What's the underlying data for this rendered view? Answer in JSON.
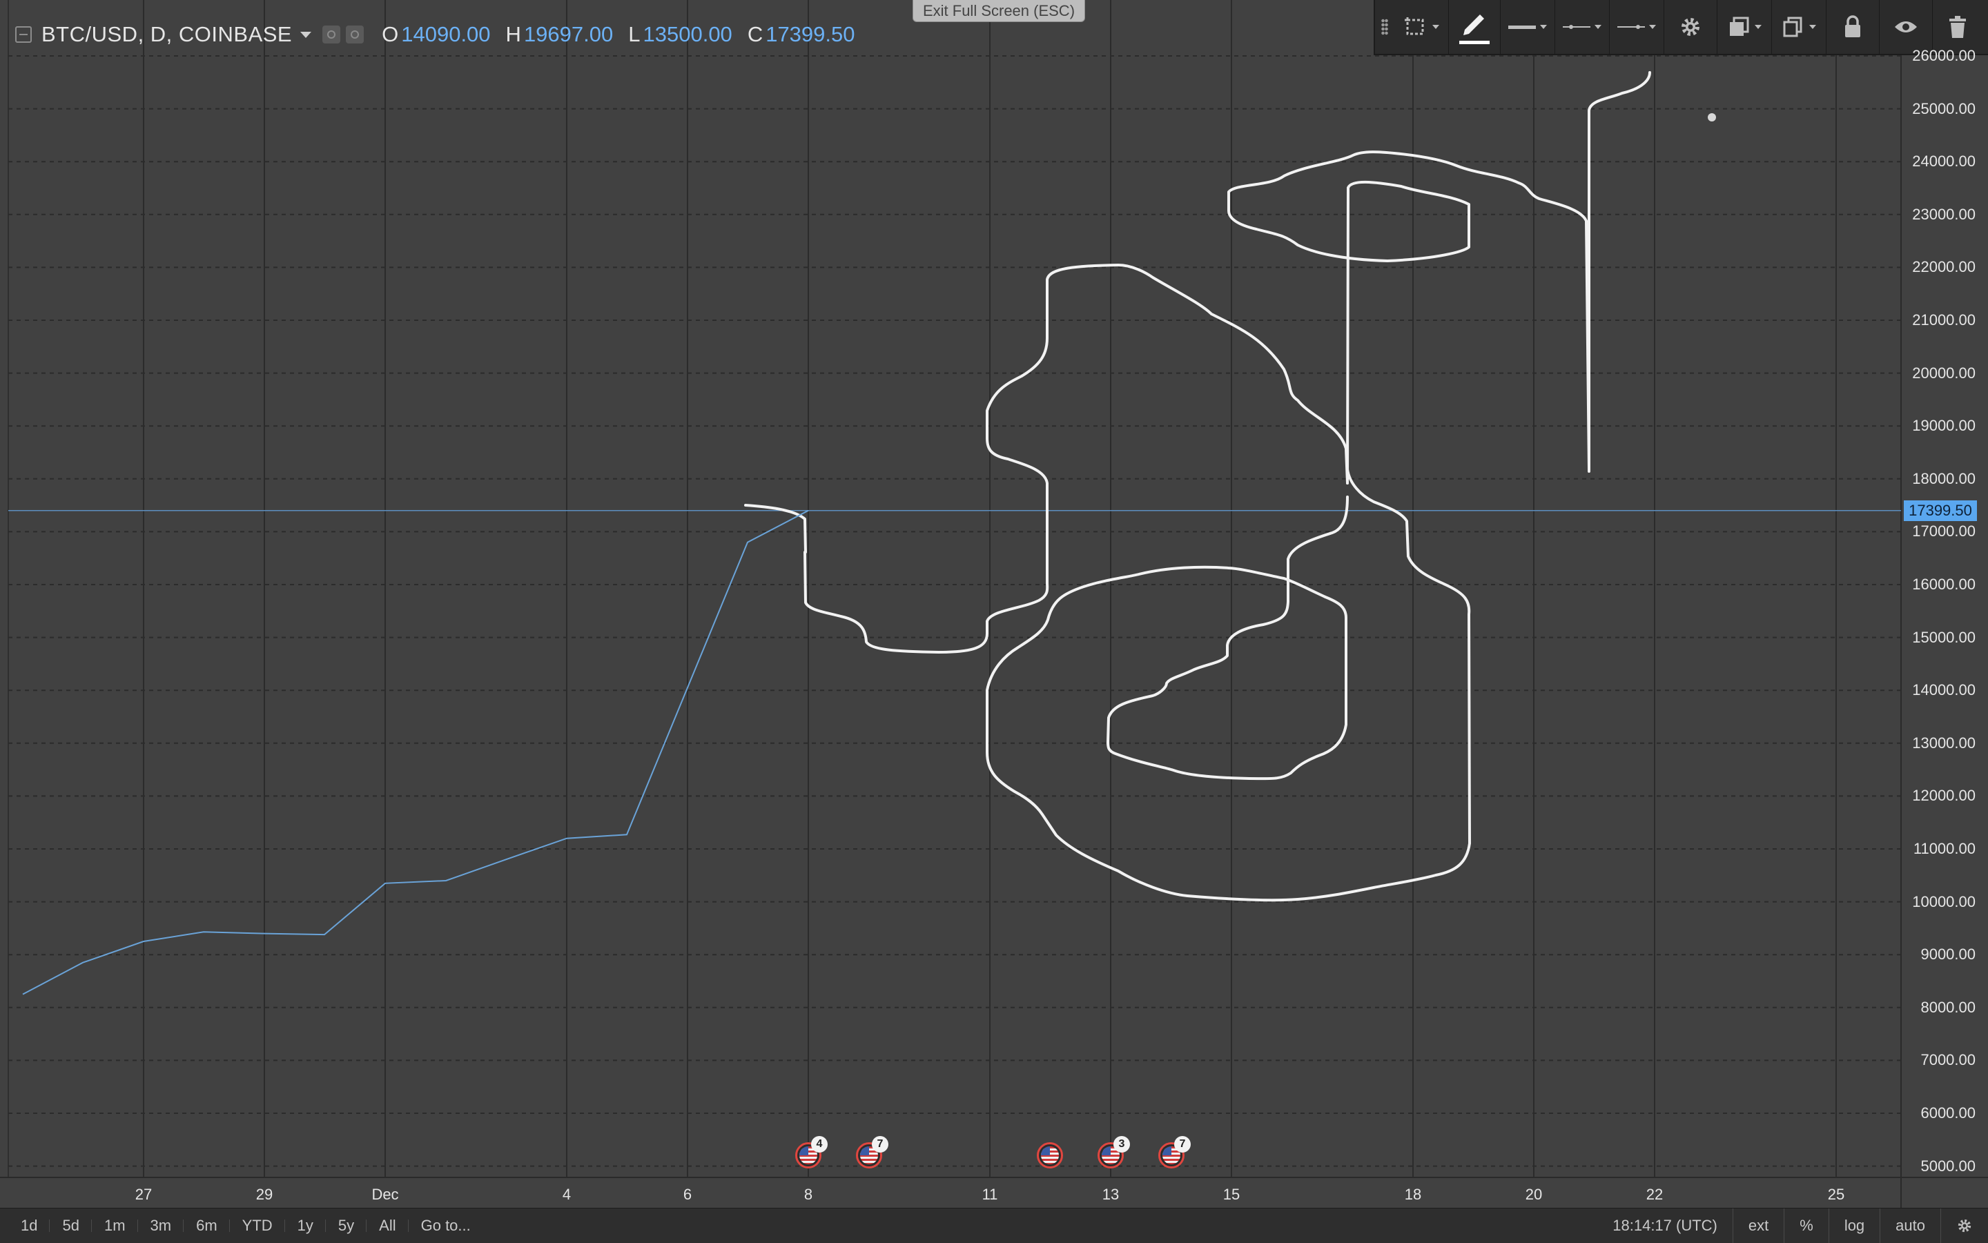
{
  "legend": {
    "symbol": "BTC/USD, D, COINBASE",
    "ohlc": [
      {
        "k": "O",
        "v": "14090.00"
      },
      {
        "k": "H",
        "v": "19697.00"
      },
      {
        "k": "L",
        "v": "13500.00"
      },
      {
        "k": "C",
        "v": "17399.50"
      }
    ]
  },
  "exit_fullscreen_label": "Exit Full Screen (ESC)",
  "toolbar_icons": [
    "drag-handle-icon",
    "selection-icon",
    "brush-icon",
    "line-thickness-icon",
    "line-style-icon",
    "line-end-icon",
    "gear-icon",
    "layers-icon",
    "copy-icon",
    "lock-icon",
    "eye-icon",
    "trash-icon"
  ],
  "chart_data": {
    "type": "line",
    "ylim": [
      5000,
      26000
    ],
    "grid": true,
    "last_price": "17399.50",
    "price_ticks": [
      "26000.00",
      "25000.00",
      "24000.00",
      "23000.00",
      "22000.00",
      "21000.00",
      "20000.00",
      "19000.00",
      "18000.00",
      "17000.00",
      "16000.00",
      "15000.00",
      "14000.00",
      "13000.00",
      "12000.00",
      "11000.00",
      "10000.00",
      "9000.00",
      "8000.00",
      "7000.00",
      "6000.00",
      "5000.00"
    ],
    "time_ticks": [
      "27",
      "29",
      "Dec",
      "4",
      "6",
      "8",
      "11",
      "13",
      "15",
      "18",
      "20",
      "22",
      "25"
    ],
    "series": [
      {
        "x": [
          "Nov 24",
          "Nov 25",
          "Nov 26",
          "Nov 27",
          "Nov 28",
          "Nov 29",
          "Nov 30",
          "Dec 1",
          "Dec 2",
          "Dec 3",
          "Dec 4",
          "Dec 5",
          "Dec 6",
          "Dec 7"
        ],
        "values": [
          8250,
          8850,
          9250,
          9430,
          9400,
          9380,
          10350,
          10400,
          10800,
          11200,
          11270,
          14050,
          16800,
          17399.5
        ]
      }
    ]
  },
  "events": [
    {
      "date": "Dec 7",
      "count": "4"
    },
    {
      "date": "Dec 8",
      "count": "7"
    },
    {
      "date": "Dec 11",
      "count": ""
    },
    {
      "date": "Dec 12",
      "count": "3"
    },
    {
      "date": "Dec 13",
      "count": "7"
    }
  ],
  "bottom": {
    "ranges": [
      "1d",
      "5d",
      "1m",
      "3m",
      "6m",
      "YTD",
      "1y",
      "5y",
      "All",
      "Go to..."
    ],
    "clock": "18:14:17 (UTC)",
    "ext": "ext",
    "percent": "%",
    "log": "log",
    "auto": "auto"
  }
}
